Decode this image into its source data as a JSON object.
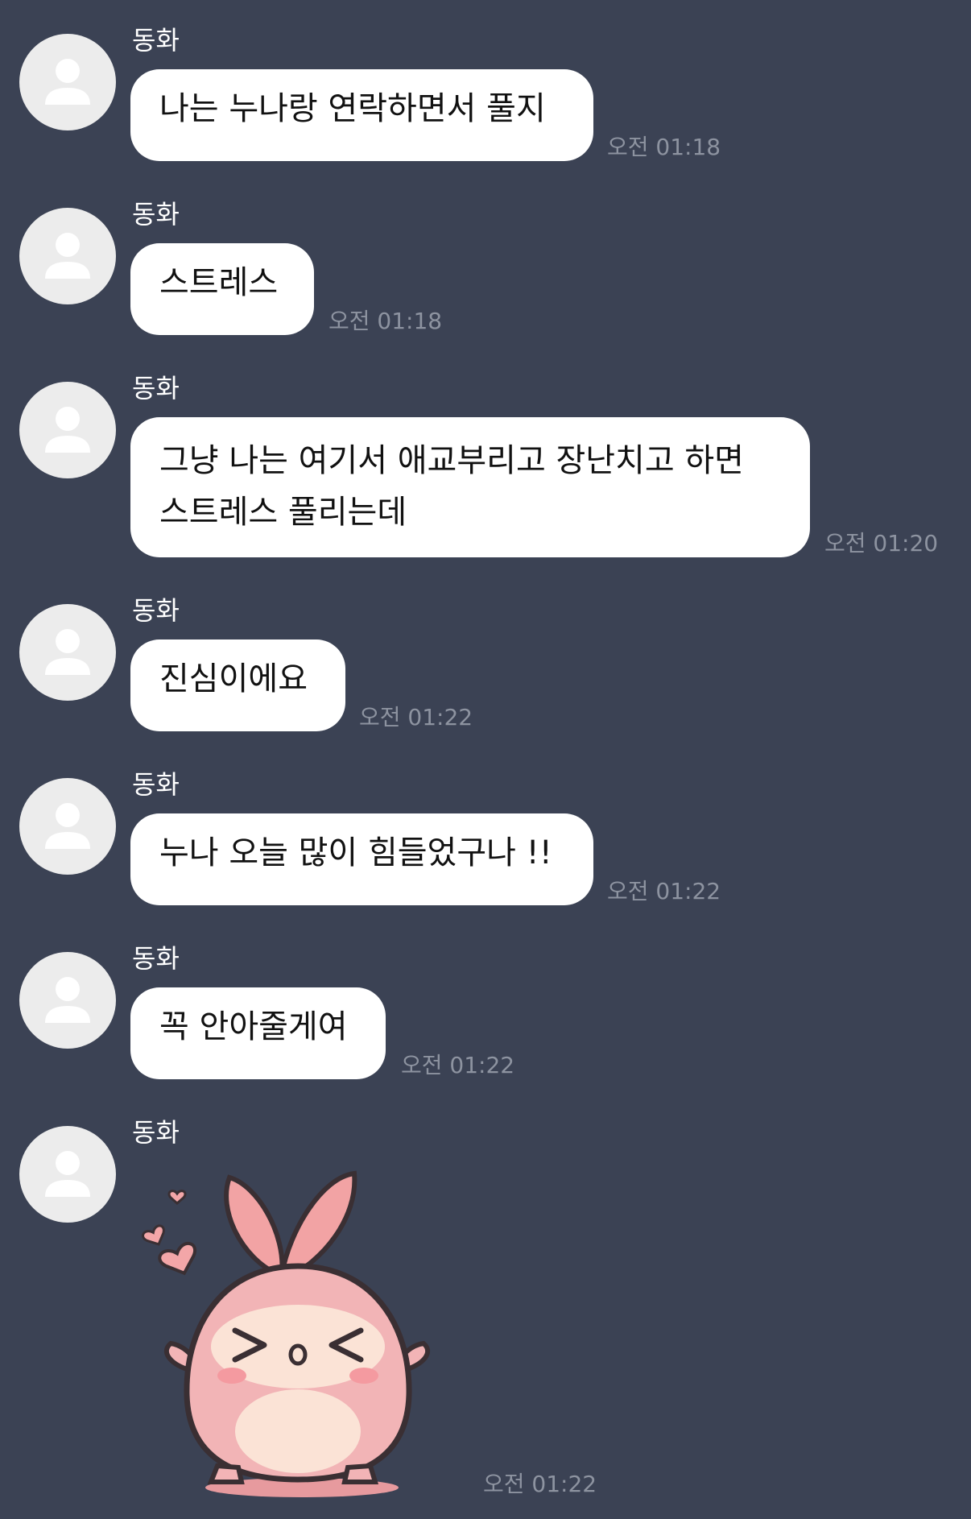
{
  "messages": [
    {
      "sender": "동화",
      "lines": [
        "나는 누나랑 연락하면서 풀지"
      ],
      "time": "오전 01:18"
    },
    {
      "sender": "동화",
      "lines": [
        "스트레스"
      ],
      "time": "오전 01:18"
    },
    {
      "sender": "동화",
      "lines": [
        "그냥 나는 여기서 애교부리고 장난치고 하면",
        "스트레스 풀리는데"
      ],
      "time": "오전 01:20"
    },
    {
      "sender": "동화",
      "lines": [
        "진심이에요"
      ],
      "time": "오전 01:22"
    },
    {
      "sender": "동화",
      "lines": [
        "누나 오늘 많이 힘들었구나 !!"
      ],
      "time": "오전 01:22"
    },
    {
      "sender": "동화",
      "lines": [
        "꼭 안아줄게여"
      ],
      "time": "오전 01:22"
    },
    {
      "sender": "동화",
      "sticker": "pink-bunny-sticker",
      "time": "오전 01:22"
    }
  ],
  "icons": {
    "avatar": "default-person-icon"
  },
  "colors": {
    "background": "#3b4254",
    "bubble": "#ffffff",
    "timestamp": "#8d93a0",
    "avatar_bg": "#ececec"
  }
}
